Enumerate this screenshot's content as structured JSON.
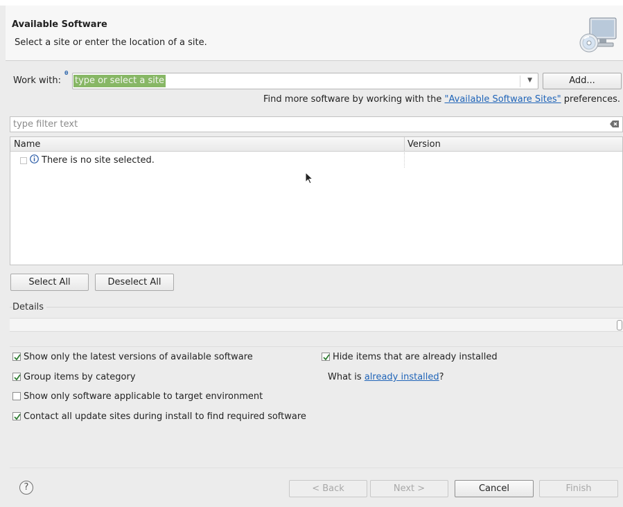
{
  "header": {
    "title": "Available Software",
    "subtitle": "Select a site or enter the location of a site."
  },
  "work_with": {
    "label": "Work with:",
    "info_marker": "θ",
    "placeholder": "type or select a site",
    "dropdown_arrow": "▼",
    "add_button": "Add..."
  },
  "more_software": {
    "prefix": "Find more software by working with the ",
    "link": "\"Available Software Sites\"",
    "suffix": " preferences."
  },
  "filter": {
    "placeholder": "type filter text"
  },
  "tree": {
    "columns": [
      "Name",
      "Version"
    ],
    "rows": [
      {
        "name": "There is no site selected.",
        "version": ""
      }
    ]
  },
  "selection_buttons": {
    "select_all": "Select All",
    "deselect_all": "Deselect All"
  },
  "details": {
    "label": "Details"
  },
  "options": {
    "latest_versions": {
      "label": "Show only the latest versions of available software",
      "checked": true
    },
    "group_by_category": {
      "label": "Group items by category",
      "checked": true
    },
    "target_env": {
      "label": "Show only software applicable to target environment",
      "checked": false
    },
    "contact_sites": {
      "label": "Contact all update sites during install to find required software",
      "checked": true
    },
    "hide_installed": {
      "label": "Hide items that are already installed",
      "checked": true
    },
    "what_is": {
      "prefix": "What is ",
      "link": "already installed",
      "suffix": "?"
    }
  },
  "footer": {
    "help": "?",
    "back": "< Back",
    "next": "Next >",
    "cancel": "Cancel",
    "finish": "Finish"
  },
  "colors": {
    "selection_green": "#87b765",
    "link_blue": "#1f64b8",
    "checkmark_green": "#2e7d32"
  }
}
